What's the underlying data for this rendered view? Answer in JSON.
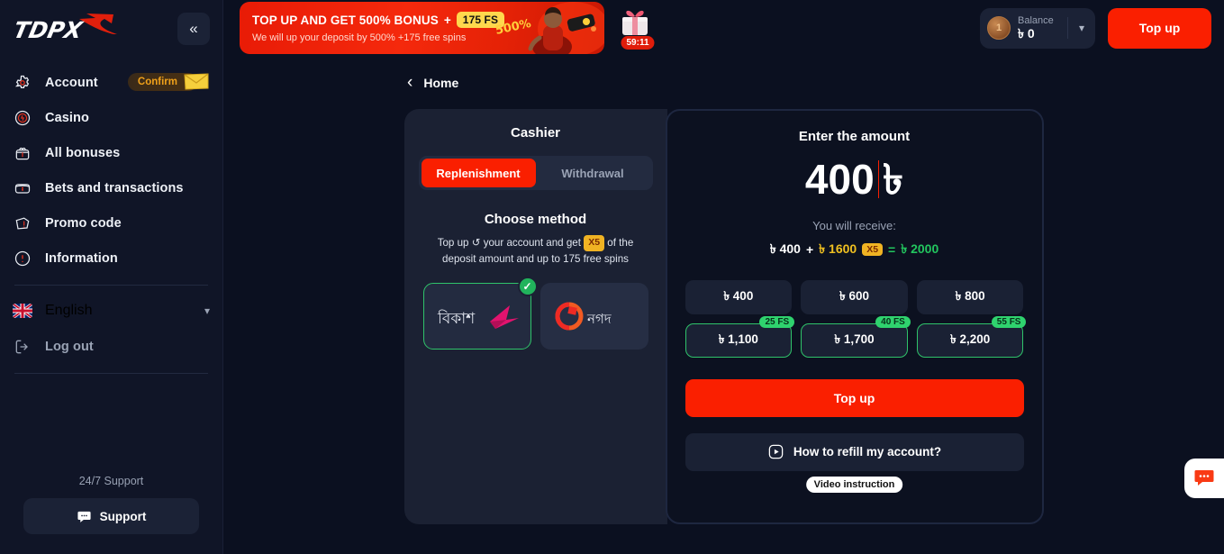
{
  "sidebar": {
    "logo_text": "TOPX",
    "collapse_icon": "chevrons-left-icon",
    "items": [
      {
        "label": "Account",
        "icon": "gear-icon",
        "badge": "Confirm"
      },
      {
        "label": "Casino",
        "icon": "casino-chip-icon"
      },
      {
        "label": "All bonuses",
        "icon": "gift-basket-icon"
      },
      {
        "label": "Bets and transactions",
        "icon": "wallet-icon"
      },
      {
        "label": "Promo code",
        "icon": "promo-ticket-icon"
      },
      {
        "label": "Information",
        "icon": "info-circle-icon"
      }
    ],
    "language": {
      "label": "English",
      "flag": "uk-flag-icon",
      "chevron": "chevron-down-icon"
    },
    "logout": {
      "label": "Log out",
      "icon": "logout-icon"
    },
    "support_heading": "24/7 Support",
    "support_button": "Support",
    "support_icon": "chat-bubble-icon"
  },
  "topbar": {
    "promo": {
      "title": "TOP UP AND GET 500% BONUS",
      "plus": "+",
      "fs_badge": "175 FS",
      "subtitle": "We will up your deposit by 500% +175 free spins",
      "art_label": "500%"
    },
    "gift": {
      "icon": "gift-box-icon",
      "timer": "59:11"
    },
    "balance": {
      "label": "Balance",
      "value": "৳ 0",
      "coin_icon": "coin-icon",
      "chevron": "chevron-down-icon"
    },
    "topup_button": "Top up"
  },
  "breadcrumb": {
    "back_icon": "chevron-left-icon",
    "label": "Home"
  },
  "cashier": {
    "title": "Cashier",
    "tabs": [
      {
        "label": "Replenishment",
        "active": true
      },
      {
        "label": "Withdrawal",
        "active": false
      }
    ],
    "choose_method_title": "Choose method",
    "choose_method_desc_a": "Top up",
    "choose_method_desc_icon": "refresh-icon",
    "choose_method_desc_b": "your account and get",
    "multiplier_badge": "X5",
    "choose_method_desc_c": "of the deposit amount and up to 175 free spins",
    "methods": [
      {
        "name": "bKash",
        "native": "বিকাশ",
        "selected": true,
        "check_icon": "check-icon"
      },
      {
        "name": "Nagad",
        "native": "নগদ",
        "selected": false
      }
    ]
  },
  "amount_panel": {
    "title": "Enter the amount",
    "value": "400",
    "currency": "৳",
    "receive_label": "You will receive:",
    "calc": {
      "base": "৳ 400",
      "plus": "+",
      "bonus": "৳ 1600",
      "multiplier": "X5",
      "equals": "=",
      "total": "৳ 2000"
    },
    "chips": [
      {
        "label": "৳ 400",
        "fs": null,
        "bonus": false
      },
      {
        "label": "৳ 600",
        "fs": null,
        "bonus": false
      },
      {
        "label": "৳ 800",
        "fs": null,
        "bonus": false
      },
      {
        "label": "৳ 1,100",
        "fs": "25 FS",
        "bonus": true
      },
      {
        "label": "৳ 1,700",
        "fs": "40 FS",
        "bonus": true
      },
      {
        "label": "৳ 2,200",
        "fs": "55 FS",
        "bonus": true
      }
    ],
    "topup_button": "Top up",
    "howto_label": "How to refill my account?",
    "howto_icon": "play-circle-icon",
    "tooltip": "Video instruction"
  },
  "chat": {
    "icon": "chat-bubble-icon"
  },
  "colors": {
    "accent_red": "#fa1f00",
    "bonus_green": "#2fc36a",
    "badge_yellow": "#ffd84d",
    "panel": "#1b2133",
    "background": "#0b1020"
  }
}
